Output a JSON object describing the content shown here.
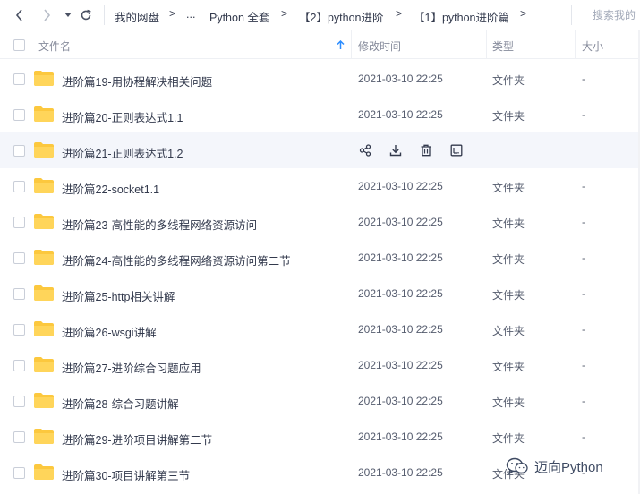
{
  "toolbar": {
    "back_icon": "chevron-left-icon",
    "forward_icon": "chevron-right-icon",
    "history_icon": "dropdown-triangle-icon",
    "refresh_icon": "refresh-icon"
  },
  "breadcrumb": {
    "items": [
      "我的网盘",
      "...",
      "Python 全套",
      "【2】python进阶",
      "【1】python进阶篇"
    ],
    "separator": ">"
  },
  "search": {
    "placeholder": "搜索我的"
  },
  "columns": {
    "name": "文件名",
    "modified": "修改时间",
    "type": "类型",
    "size": "大小"
  },
  "rows": [
    {
      "name": "进阶篇19-用协程解决相关问题",
      "modified": "2021-03-10 22:25",
      "type": "文件夹",
      "size": "-"
    },
    {
      "name": "进阶篇20-正则表达式1.1",
      "modified": "2021-03-10 22:25",
      "type": "文件夹",
      "size": "-"
    },
    {
      "name": "进阶篇21-正则表达式1.2",
      "modified": "",
      "type": "",
      "size": ""
    },
    {
      "name": "进阶篇22-socket1.1",
      "modified": "2021-03-10 22:25",
      "type": "文件夹",
      "size": "-"
    },
    {
      "name": "进阶篇23-高性能的多线程网络资源访问",
      "modified": "2021-03-10 22:25",
      "type": "文件夹",
      "size": "-"
    },
    {
      "name": "进阶篇24-高性能的多线程网络资源访问第二节",
      "modified": "2021-03-10 22:25",
      "type": "文件夹",
      "size": "-"
    },
    {
      "name": "进阶篇25-http相关讲解",
      "modified": "2021-03-10 22:25",
      "type": "文件夹",
      "size": "-"
    },
    {
      "name": "进阶篇26-wsgi讲解",
      "modified": "2021-03-10 22:25",
      "type": "文件夹",
      "size": "-"
    },
    {
      "name": "进阶篇27-进阶综合习题应用",
      "modified": "2021-03-10 22:25",
      "type": "文件夹",
      "size": "-"
    },
    {
      "name": "进阶篇28-综合习题讲解",
      "modified": "2021-03-10 22:25",
      "type": "文件夹",
      "size": "-"
    },
    {
      "name": "进阶篇29-进阶项目讲解第二节",
      "modified": "2021-03-10 22:25",
      "type": "文件夹",
      "size": "-"
    },
    {
      "name": "进阶篇30-项目讲解第三节",
      "modified": "2021-03-10 22:25",
      "type": "文件夹",
      "size": "-"
    }
  ],
  "hover_actions": [
    "share-icon",
    "download-icon",
    "delete-icon",
    "more-icon"
  ],
  "watermark": {
    "text": "迈向Python"
  },
  "colors": {
    "folder": "#fcc83e",
    "sort_arrow": "#2b8cff",
    "hover_row": "#f4f6fb"
  }
}
